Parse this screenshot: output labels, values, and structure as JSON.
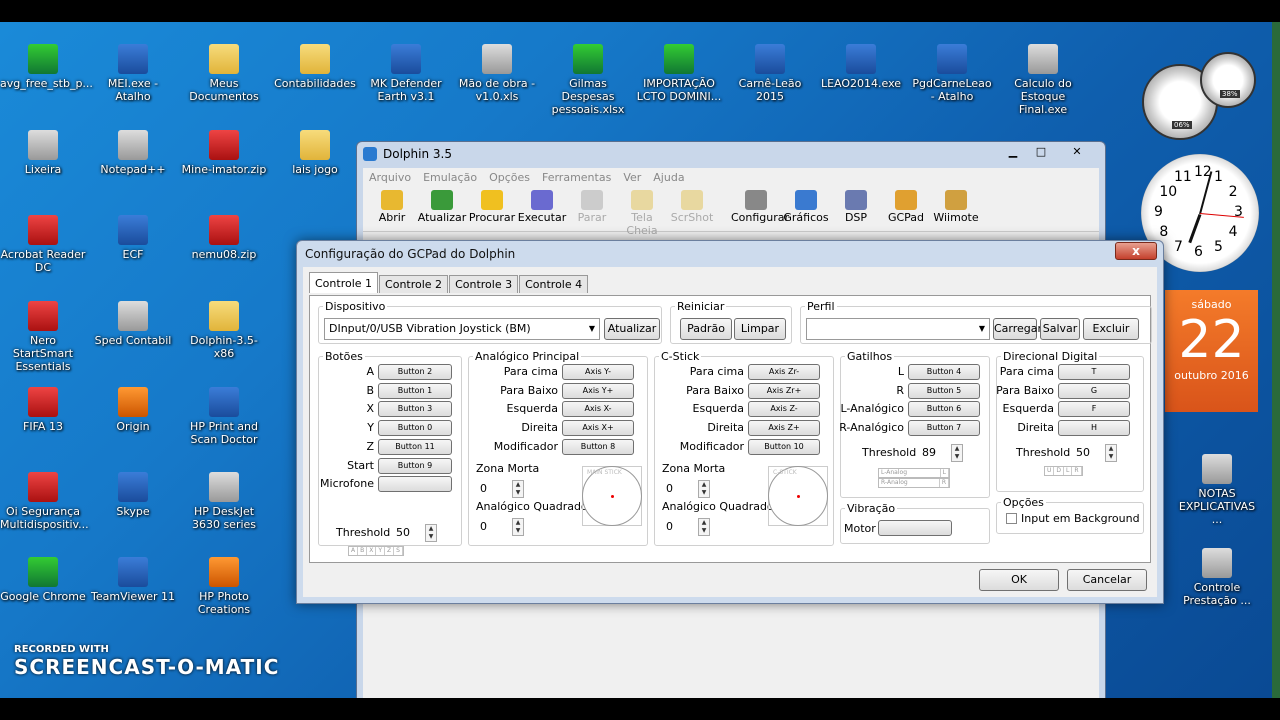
{
  "desktop_icons": [
    {
      "label": "avg_free_stb_p...",
      "cls": "green"
    },
    {
      "label": "MEI.exe - Atalho",
      "cls": "exe"
    },
    {
      "label": "Meus Documentos",
      "cls": "folder"
    },
    {
      "label": "Contabilidades",
      "cls": "folder"
    },
    {
      "label": "MK Defender Earth v3.1",
      "cls": "exe"
    },
    {
      "label": "Mão de obra -v1.0.xls",
      "cls": "gray"
    },
    {
      "label": "Gilmas Despesas pessoais.xlsx",
      "cls": "green"
    },
    {
      "label": "IMPORTAÇÃO LCTO DOMINI...",
      "cls": "green"
    },
    {
      "label": "Carnê-Leão 2015",
      "cls": "exe"
    },
    {
      "label": "LEAO2014.exe",
      "cls": "exe"
    },
    {
      "label": "PgdCarneLeao - Atalho",
      "cls": "exe"
    },
    {
      "label": "Calculo do Estoque Final.exe",
      "cls": "gray"
    },
    {
      "label": "Lixeira",
      "cls": "gray"
    },
    {
      "label": "Notepad++",
      "cls": "gray"
    },
    {
      "label": "Mine-imator.zip",
      "cls": "red"
    },
    {
      "label": "lais jogo",
      "cls": "folder"
    },
    {
      "label": "Acrobat Reader DC",
      "cls": "red"
    },
    {
      "label": "ECF",
      "cls": "exe"
    },
    {
      "label": "nemu08.zip",
      "cls": "red"
    },
    {
      "label": "Nero StartSmart Essentials",
      "cls": "red"
    },
    {
      "label": "Sped Contabil",
      "cls": "gray"
    },
    {
      "label": "Dolphin-3.5-x86",
      "cls": "folder"
    },
    {
      "label": "FIFA 13",
      "cls": "red"
    },
    {
      "label": "Origin",
      "cls": "orange"
    },
    {
      "label": "HP Print and Scan Doctor",
      "cls": "exe"
    },
    {
      "label": "Oi Segurança Multidispositiv...",
      "cls": "red"
    },
    {
      "label": "Skype",
      "cls": "exe"
    },
    {
      "label": "HP DeskJet 3630 series",
      "cls": "gray"
    },
    {
      "label": "Google Chrome",
      "cls": "green"
    },
    {
      "label": "TeamViewer 11",
      "cls": "exe"
    },
    {
      "label": "HP Photo Creations",
      "cls": "orange"
    },
    {
      "label": "NOTAS EXPLICATIVAS ...",
      "cls": "gray"
    },
    {
      "label": "Controle Prestação ...",
      "cls": "gray"
    }
  ],
  "dolphin": {
    "title": "Dolphin 3.5",
    "menu": [
      "Arquivo",
      "Emulação",
      "Opções",
      "Ferramentas",
      "Ver",
      "Ajuda"
    ],
    "toolbar": [
      {
        "label": "Abrir",
        "enabled": true,
        "color": "#e8b830"
      },
      {
        "label": "Atualizar",
        "enabled": true,
        "color": "#3a9a3a"
      },
      {
        "label": "Procurar",
        "enabled": true,
        "color": "#f0c020"
      },
      {
        "label": "Executar",
        "enabled": true,
        "color": "#6a6ad0"
      },
      {
        "label": "Parar",
        "enabled": false,
        "color": "#cccccc"
      },
      {
        "label": "Tela Cheia",
        "enabled": false,
        "color": "#e8d8a0"
      },
      {
        "label": "ScrShot",
        "enabled": false,
        "color": "#e8d8a0"
      },
      {
        "label": "Configurar",
        "enabled": true,
        "color": "#888888"
      },
      {
        "label": "Gráficos",
        "enabled": true,
        "color": "#3a7ad0"
      },
      {
        "label": "DSP",
        "enabled": true,
        "color": "#6a7ab0"
      },
      {
        "label": "GCPad",
        "enabled": true,
        "color": "#e0a030"
      },
      {
        "label": "Wiimote",
        "enabled": true,
        "color": "#d0a040"
      }
    ]
  },
  "gcpad": {
    "title": "Configuração do GCPad do Dolphin",
    "close": "x",
    "tabs": [
      "Controle 1",
      "Controle 2",
      "Controle 3",
      "Controle 4"
    ],
    "dispositivo": {
      "legend": "Dispositivo",
      "value": "DInput/0/USB Vibration Joystick (BM)",
      "refresh": "Atualizar"
    },
    "reiniciar": {
      "legend": "Reiniciar",
      "padrao": "Padrão",
      "limpar": "Limpar"
    },
    "perfil": {
      "legend": "Perfil",
      "value": "",
      "carregar": "Carregar",
      "salvar": "Salvar",
      "excluir": "Excluir"
    },
    "botoes": {
      "legend": "Botões",
      "rows": [
        {
          "label": "A",
          "value": "Button 2"
        },
        {
          "label": "B",
          "value": "Button 1"
        },
        {
          "label": "X",
          "value": "Button 3"
        },
        {
          "label": "Y",
          "value": "Button 0"
        },
        {
          "label": "Z",
          "value": "Button 11"
        },
        {
          "label": "Start",
          "value": "Button 9"
        },
        {
          "label": "Microfone",
          "value": ""
        }
      ],
      "threshold_label": "Threshold",
      "threshold": "50",
      "strip": [
        "A",
        "B",
        "X",
        "Y",
        "Z",
        "S"
      ]
    },
    "analogico": {
      "legend": "Analógico Principal",
      "rows": [
        {
          "label": "Para cima",
          "value": "Axis Y-"
        },
        {
          "label": "Para Baixo",
          "value": "Axis Y+"
        },
        {
          "label": "Esquerda",
          "value": "Axis X-"
        },
        {
          "label": "Direita",
          "value": "Axis X+"
        },
        {
          "label": "Modificador",
          "value": "Button 8"
        }
      ],
      "zona_label": "Zona Morta",
      "zona": "0",
      "quad_label": "Analógico Quadrado",
      "quad": "0",
      "stick_label": "MAIN STICK"
    },
    "cstick": {
      "legend": "C-Stick",
      "rows": [
        {
          "label": "Para cima",
          "value": "Axis Zr-"
        },
        {
          "label": "Para Baixo",
          "value": "Axis Zr+"
        },
        {
          "label": "Esquerda",
          "value": "Axis Z-"
        },
        {
          "label": "Direita",
          "value": "Axis Z+"
        },
        {
          "label": "Modificador",
          "value": "Button 10"
        }
      ],
      "zona_label": "Zona Morta",
      "zona": "0",
      "quad_label": "Analógico Quadrado",
      "quad": "0",
      "stick_label": "C-STICK"
    },
    "gatilhos": {
      "legend": "Gatilhos",
      "rows": [
        {
          "label": "L",
          "value": "Button 4"
        },
        {
          "label": "R",
          "value": "Button 5"
        },
        {
          "label": "L-Analógico",
          "value": "Button 6"
        },
        {
          "label": "R-Analógico",
          "value": "Button 7"
        }
      ],
      "threshold_label": "Threshold",
      "threshold": "89",
      "bar1": "L-Analog",
      "bar1b": "L",
      "bar2": "R-Analog",
      "bar2b": "R"
    },
    "vibracao": {
      "legend": "Vibração",
      "motor_label": "Motor",
      "motor": ""
    },
    "direcional": {
      "legend": "Direcional Digital",
      "rows": [
        {
          "label": "Para cima",
          "value": "T"
        },
        {
          "label": "Para Baixo",
          "value": "G"
        },
        {
          "label": "Esquerda",
          "value": "F"
        },
        {
          "label": "Direita",
          "value": "H"
        }
      ],
      "threshold_label": "Threshold",
      "threshold": "50",
      "strip": [
        "U",
        "D",
        "L",
        "R"
      ]
    },
    "opcoes": {
      "legend": "Opções",
      "bg_label": "Input em Background",
      "bg_checked": false
    },
    "ok": "OK",
    "cancel": "Cancelar"
  },
  "gadgets": {
    "calendar": {
      "day_name": "sábado",
      "day": "22",
      "month_year": "outubro 2016"
    },
    "meter": {
      "cpu": "06%",
      "mem": "38%"
    },
    "clock_numbers": [
      "12",
      "1",
      "2",
      "3",
      "4",
      "5",
      "6",
      "7",
      "8",
      "9",
      "10",
      "11"
    ]
  },
  "watermark": {
    "recorded": "RECORDED WITH",
    "brand": "SCREENCAST-O-MATIC"
  }
}
